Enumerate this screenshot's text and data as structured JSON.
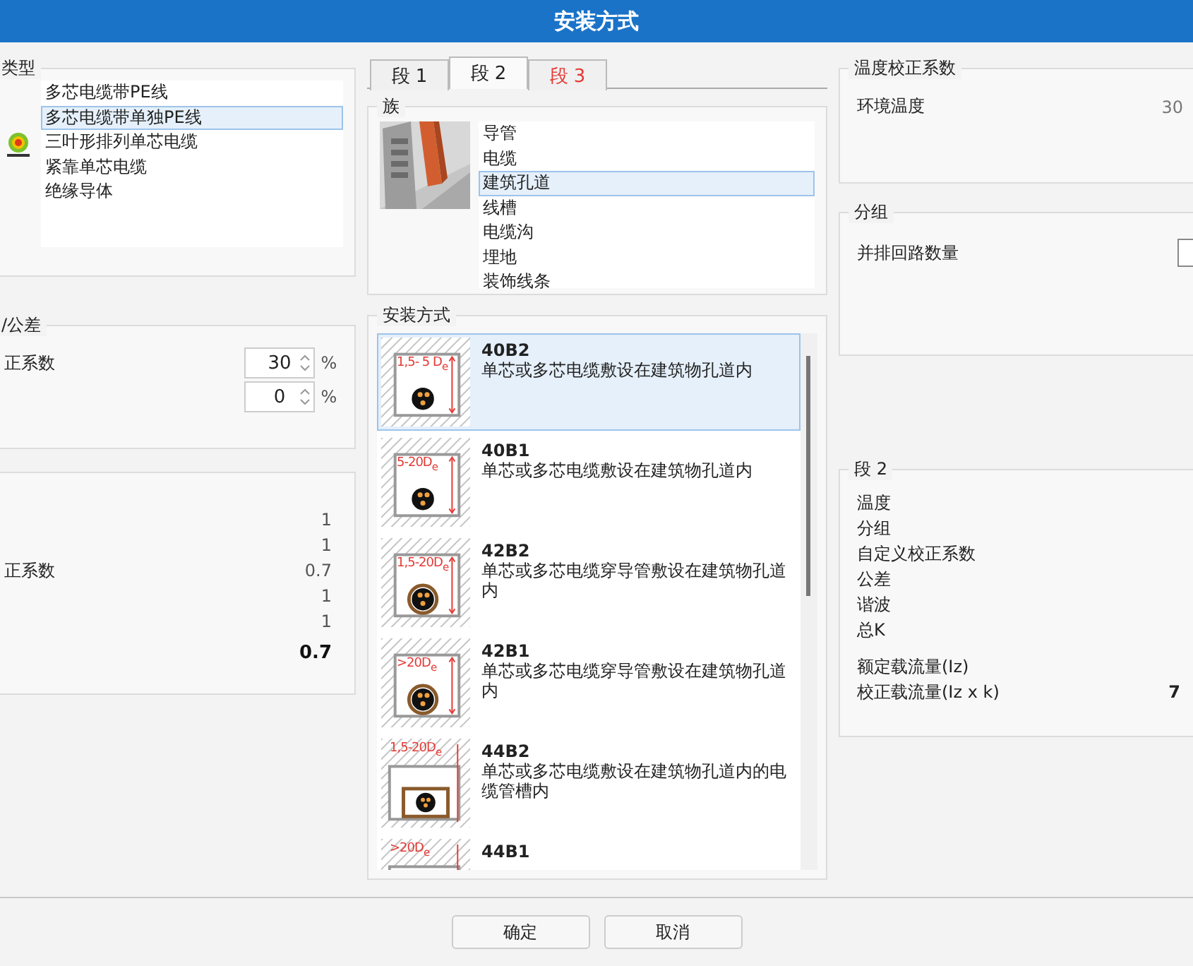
{
  "window": {
    "title": "安装方式"
  },
  "cable_type": {
    "title": "类型",
    "items": [
      {
        "label": "多芯电缆带PE线",
        "selected": false
      },
      {
        "label": "多芯电缆带单独PE线",
        "selected": true
      },
      {
        "label": "三叶形排列单芯电缆",
        "selected": false
      },
      {
        "label": "紧靠单芯电缆",
        "selected": false
      },
      {
        "label": "绝缘导体",
        "selected": false
      }
    ]
  },
  "factors": {
    "title": "/公差",
    "rows": [
      {
        "label": "正系数",
        "value": "30",
        "unit": "%"
      },
      {
        "value": "0",
        "unit": "%"
      }
    ]
  },
  "summary": {
    "rows": [
      {
        "value": "1",
        "kind": "plain"
      },
      {
        "value": "1",
        "kind": "plain"
      },
      {
        "label": "正系数",
        "value": "0.7",
        "kind": "plain"
      },
      {
        "value": "1",
        "kind": "plain"
      },
      {
        "value": "1",
        "kind": "plain"
      },
      {
        "value": "0.7",
        "kind": "total"
      }
    ]
  },
  "tabs": [
    {
      "label": "段 1",
      "selected": false,
      "color": "#222222"
    },
    {
      "label": "段 2",
      "selected": true,
      "color": "#222222"
    },
    {
      "label": "段 3",
      "selected": false,
      "color": "#e53935"
    }
  ],
  "family": {
    "title": "族",
    "items": [
      {
        "label": "导管",
        "selected": false
      },
      {
        "label": "电缆",
        "selected": false
      },
      {
        "label": "建筑孔道",
        "selected": true
      },
      {
        "label": "线槽",
        "selected": false
      },
      {
        "label": "电缆沟",
        "selected": false
      },
      {
        "label": "埋地",
        "selected": false
      },
      {
        "label": "装饰线条",
        "selected": false
      }
    ]
  },
  "install": {
    "title": "安装方式",
    "items": [
      {
        "code": "40B2",
        "description": "单芯或多芯电缆敷设在建筑物孔道内",
        "dim": "1,5- 5 D$_{e}$",
        "kind": "box",
        "selected": true
      },
      {
        "code": "40B1",
        "description": "单芯或多芯电缆敷设在建筑物孔道内",
        "dim": "5-20D$_{e}$",
        "kind": "box",
        "selected": false
      },
      {
        "code": "42B2",
        "description": "单芯或多芯电缆穿导管敷设在建筑物孔道内",
        "dim": "1,5-20D$_{e}$",
        "kind": "conduit",
        "selected": false
      },
      {
        "code": "42B1",
        "description": "单芯或多芯电缆穿导管敷设在建筑物孔道内",
        "dim": ">20D$_{e}$",
        "kind": "conduit",
        "selected": false
      },
      {
        "code": "44B2",
        "description": "单芯或多芯电缆敷设在建筑物孔道内的电缆管槽内",
        "dim": "1,5-20D$_{e}$",
        "kind": "trunking",
        "selected": false
      },
      {
        "code": "44B1",
        "dim": ">20D$_{e}$",
        "kind": "trunking",
        "selected": false
      }
    ]
  },
  "temperature": {
    "title": "温度校正系数",
    "label": "环境温度",
    "value": "30"
  },
  "grouping": {
    "title": "分组",
    "label": "并排回路数量"
  },
  "segment": {
    "title": "段 2",
    "rows": [
      "温度",
      "分组",
      "自定义校正系数",
      "公差",
      "谐波",
      "总K"
    ],
    "currents": [
      {
        "label": "额定载流量(Iz)"
      },
      {
        "label": "校正载流量(Iz x k)",
        "value": "7"
      }
    ]
  },
  "buttons": [
    "确定",
    "取消"
  ]
}
